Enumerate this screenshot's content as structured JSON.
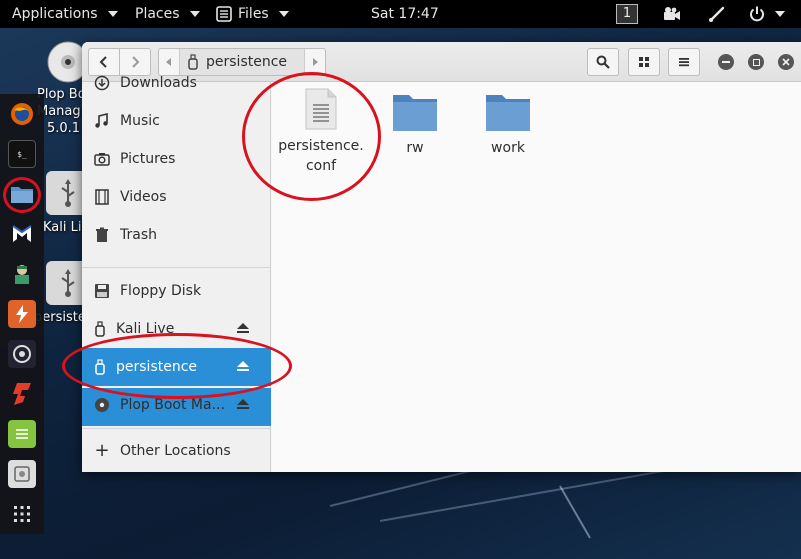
{
  "top_panel": {
    "applications": "Applications",
    "places": "Places",
    "files": "Files",
    "clock": "Sat 17:47",
    "workspace": "1"
  },
  "desktop": {
    "icons": [
      {
        "label_line1": "Plop Bo",
        "label_line2": "Manag",
        "label_line3": "5.0.1"
      },
      {
        "label": "Kali Liv"
      },
      {
        "label": "persiste"
      }
    ]
  },
  "window": {
    "path_segment": "persistence",
    "sidebar": {
      "items": [
        {
          "label": "Downloads"
        },
        {
          "label": "Music"
        },
        {
          "label": "Pictures"
        },
        {
          "label": "Videos"
        },
        {
          "label": "Trash"
        },
        {
          "label": "Floppy Disk"
        },
        {
          "label": "Kali Live"
        },
        {
          "label": "persistence"
        },
        {
          "label": "Plop Boot Ma..."
        },
        {
          "label": "Other Locations"
        }
      ]
    },
    "files": [
      {
        "name": "persistence.\nconf",
        "type": "text-file"
      },
      {
        "name": "rw",
        "type": "folder"
      },
      {
        "name": "work",
        "type": "folder"
      }
    ]
  },
  "colors": {
    "selection": "#2a8fd6",
    "annotation": "#d8121e",
    "folder": "#5b8fc7"
  }
}
